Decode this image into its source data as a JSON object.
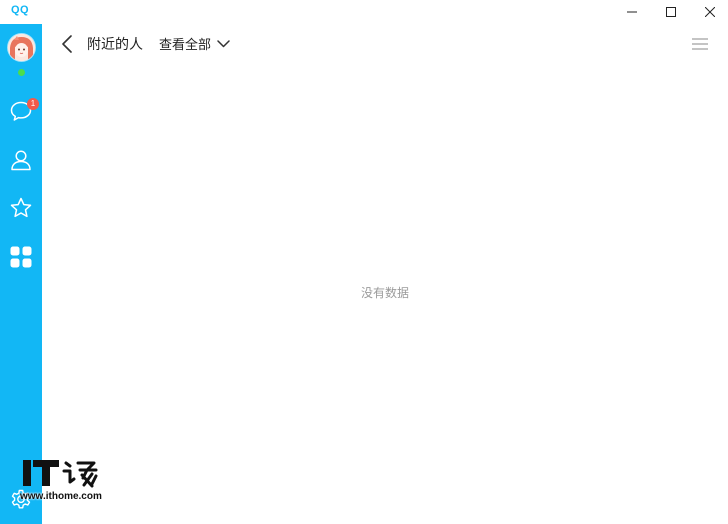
{
  "window": {
    "title": "QQ"
  },
  "sidebar": {
    "unread_badge": "1",
    "items": [
      {
        "name": "messages",
        "icon": "chat-bubble-icon"
      },
      {
        "name": "contacts",
        "icon": "person-icon"
      },
      {
        "name": "favorites",
        "icon": "star-icon"
      },
      {
        "name": "apps",
        "icon": "grid-icon"
      },
      {
        "name": "settings",
        "icon": "gear-icon"
      }
    ],
    "status_color": "#4cdd4c"
  },
  "header": {
    "title": "附近的人",
    "filter_label": "查看全部"
  },
  "main": {
    "empty_text": "没有数据"
  },
  "watermark": {
    "url": "www.ithome.com"
  },
  "colors": {
    "accent": "#12b7f5",
    "badge": "#f15a4a"
  }
}
